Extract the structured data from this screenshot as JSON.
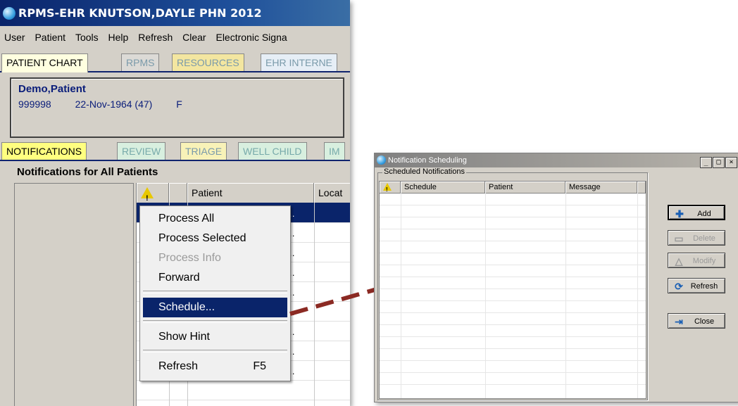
{
  "colors": {
    "title_blue": "#0a246a",
    "arrow": "#8b2a23",
    "patient_text": "#0a1d7a",
    "highlight": "#0a246a"
  },
  "rpms": {
    "title": "RPMS-EHR KNUTSON,DAYLE   PHN 2012",
    "menu": [
      "User",
      "Patient",
      "Tools",
      "Help",
      "Refresh",
      "Clear",
      "Electronic Signa"
    ],
    "tabs": [
      "PATIENT CHART",
      "RPMS",
      "RESOURCES",
      "EHR INTERNE"
    ],
    "patient": {
      "name": "Demo,Patient",
      "id": "999998",
      "dob": "22-Nov-1964 (47)",
      "sex": "F"
    },
    "subtabs": [
      "NOTIFICATIONS",
      "REVIEW",
      "TRIAGE",
      "WELL CHILD",
      "IM"
    ],
    "heading": "Notifications for All Patients",
    "grid_columns": [
      "!",
      "",
      "Patient",
      "Locat"
    ],
    "row_fragments": [
      "…",
      "…",
      "…",
      "…",
      "…",
      "…",
      "…",
      "…",
      "…"
    ]
  },
  "context_menu": {
    "items": [
      {
        "label": "Process All"
      },
      {
        "label": "Process Selected"
      },
      {
        "label": "Process Info"
      },
      {
        "label": "Forward"
      },
      {
        "label": "Schedule..."
      },
      {
        "label": "Show Hint"
      },
      {
        "label": "Refresh",
        "shortcut": "F5"
      }
    ]
  },
  "dialog": {
    "title": "Notification Scheduling",
    "window_buttons": [
      "_",
      "□",
      "×"
    ],
    "group_label": "Scheduled Notifications",
    "columns": [
      "!",
      "Schedule",
      "Patient",
      "Message"
    ],
    "buttons": {
      "add": "Add",
      "delete": "Delete",
      "modify": "Modify",
      "refresh": "Refresh",
      "close": "Close"
    }
  }
}
